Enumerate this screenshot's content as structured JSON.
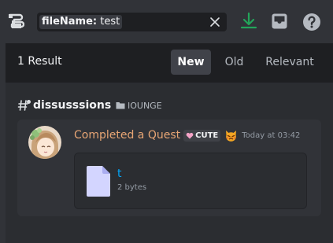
{
  "search": {
    "filter_key": "fileName:",
    "filter_value": "test"
  },
  "icons": {
    "threads": "threads-icon",
    "clear": "close-icon",
    "download": "download-icon",
    "inbox": "inbox-icon",
    "help": "help-icon",
    "channel": "forum-channel-icon",
    "category": "folder-icon",
    "file": "file-icon"
  },
  "results": {
    "count_label": "1 Result",
    "tabs": [
      {
        "label": "New",
        "selected": true
      },
      {
        "label": "Old",
        "selected": false
      },
      {
        "label": "Relevant",
        "selected": false
      }
    ]
  },
  "channel": {
    "name": "dissusssions",
    "category": "lOUNGE"
  },
  "message": {
    "author": "Completed a Quest",
    "tag": "CUTE",
    "timestamp": "Today at 03:42",
    "attachment": {
      "name": "t",
      "size": "2 bytes"
    }
  },
  "colors": {
    "background": "#313338",
    "panel": "#2b2d31",
    "header": "#1e1f22",
    "author": "#e7a574",
    "link": "#00a8fc",
    "download": "#23a55a"
  }
}
